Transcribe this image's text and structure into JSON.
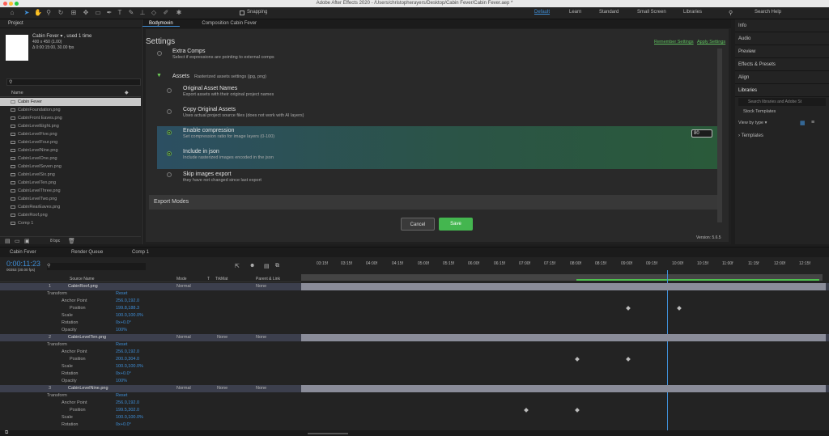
{
  "app": {
    "window_title": "Adobe After Effects 2020 - /Users/christopherayers/Desktop/Cabin Fever/Cabin Fever.aep *"
  },
  "toolbar": {
    "snapping_label": "Snapping",
    "workspaces": [
      "Default",
      "Learn",
      "Standard",
      "Small Screen",
      "Libraries"
    ],
    "search_placeholder": "Search Help"
  },
  "project": {
    "panel_label": "Project",
    "comp_name": "Cabin Fever ▾ , used 1 time",
    "comp_dims": "400 x 450 (1.00)",
    "comp_dur": "Δ 0:00:15:00, 30.00 fps",
    "name_col": "Name",
    "bpc": "8 bpc",
    "files": [
      "Cabin Fever",
      "CabinFoundation.png",
      "CabinFront Eaves.png",
      "CabinLevelEight.png",
      "CabinLevelFive.png",
      "CabinLevelFour.png",
      "CabinLevelNine.png",
      "CabinLevelOne.png",
      "CabinLevelSeven.png",
      "CabinLevelSix.png",
      "CabinLevelTen.png",
      "CabinLevelThree.png",
      "CabinLevelTwo.png",
      "CabinRearEaves.png",
      "CabinRoof.png",
      "Comp 1"
    ]
  },
  "bodymovin": {
    "tab_bodymovin": "Bodymovin",
    "tab_comp": "Composition Cabin Fever",
    "heading": "Settings",
    "remember": "Remember Settings",
    "apply": "Apply Settings",
    "extra_title": "Extra Comps",
    "extra_sub": "Select if expressions are pointing to external comps",
    "assets_title": "Assets",
    "assets_sub": "Rasterized assets settings (jpg, png)",
    "options": [
      {
        "title": "Original Asset Names",
        "sub": "Export assets with their original project names"
      },
      {
        "title": "Copy Original Assets",
        "sub": "Uses actual project source files (does not work with AI layers)"
      },
      {
        "title": "Enable compression",
        "sub": "Set compression ratio for image layers (0-100)"
      },
      {
        "title": "Include in json",
        "sub": "Include rasterized images encoded in the json"
      },
      {
        "title": "Skip images export",
        "sub": "they have not changed since last export"
      }
    ],
    "compression_value": "80",
    "export_modes": "Export Modes",
    "cancel": "Cancel",
    "save": "Save",
    "version": "Version: 5.6.5"
  },
  "right_panel": {
    "items": [
      "Info",
      "Audio",
      "Preview",
      "Effects & Presets",
      "Align"
    ],
    "libraries": "Libraries",
    "lib_search": "Search libraries and Adobe St",
    "stock": "Stock Templates",
    "viewby": "View by type ▾",
    "templates": "Templates"
  },
  "timeline": {
    "tab_cabin": "Cabin Fever",
    "tab_render": "Render Queue",
    "tab_comp1": "Comp 1",
    "timecode": "0:00:11:23",
    "timecode_sub": "00353 (30.00 fps)",
    "cols": {
      "source": "Source Name",
      "mode": "Mode",
      "t": "T",
      "trkmat": "TrkMat",
      "parent": "Parent & Link"
    },
    "ruler": [
      "00:00f",
      "03:15f",
      "04:00f",
      "04:15f",
      "05:00f",
      "05:15f",
      "06:00f",
      "06:15f",
      "07:00f",
      "07:15f",
      "08:00f",
      "08:15f",
      "09:00f",
      "09:15f",
      "10:00f",
      "10:15f",
      "11:00f",
      "11:15f",
      "12:00f",
      "12:15f",
      "13:00f",
      "13:15f",
      "14:00f",
      "14:15f"
    ],
    "layers": [
      {
        "num": "1",
        "name": "CabinRoof.png",
        "mode": "Normal",
        "trkmat": "",
        "parent": "None",
        "props": [
          {
            "n": "Anchor Point",
            "v": "256.0,192.0"
          },
          {
            "n": "Position",
            "v": "199.8,188.3"
          },
          {
            "n": "Scale",
            "v": "100.0,100.0%"
          },
          {
            "n": "Rotation",
            "v": "0x+0.0°"
          },
          {
            "n": "Opacity",
            "v": "100%"
          }
        ]
      },
      {
        "num": "2",
        "name": "CabinLevelTen.png",
        "mode": "Normal",
        "trkmat": "None",
        "parent": "None",
        "props": [
          {
            "n": "Anchor Point",
            "v": "256.0,192.0"
          },
          {
            "n": "Position",
            "v": "200.0,304.0"
          },
          {
            "n": "Scale",
            "v": "100.0,100.0%"
          },
          {
            "n": "Rotation",
            "v": "0x+0.0°"
          },
          {
            "n": "Opacity",
            "v": "100%"
          }
        ]
      },
      {
        "num": "3",
        "name": "CabinLevelNine.png",
        "mode": "Normal",
        "trkmat": "None",
        "parent": "None",
        "props": [
          {
            "n": "Anchor Point",
            "v": "256.0,192.0"
          },
          {
            "n": "Position",
            "v": "199.5,302.0"
          },
          {
            "n": "Scale",
            "v": "100.0,100.0%"
          },
          {
            "n": "Rotation",
            "v": "0x+0.0°"
          }
        ]
      }
    ],
    "transform": "Transform",
    "reset": "Reset"
  }
}
